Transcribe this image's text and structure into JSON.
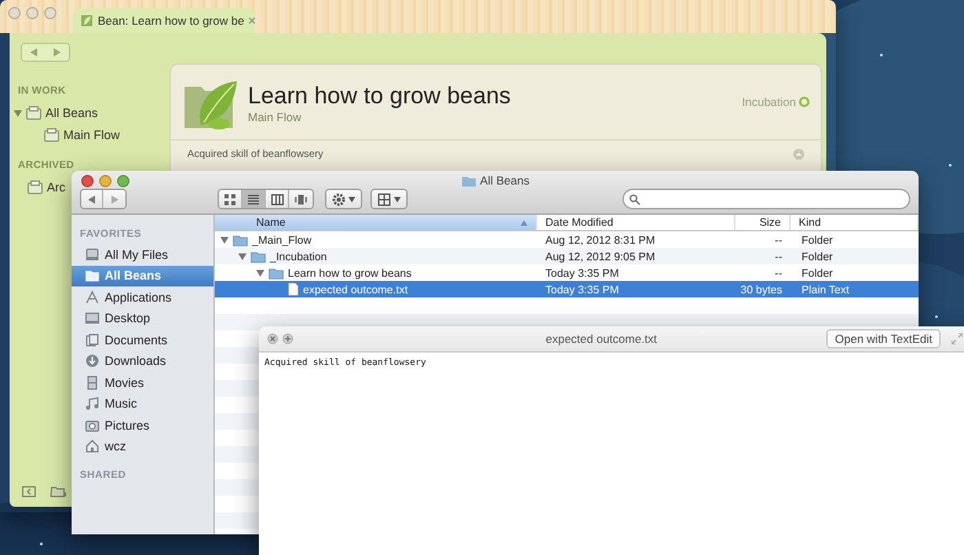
{
  "bean_window": {
    "tab_title": "Bean: Learn how to grow be",
    "sidebar": [
      {
        "heading": "IN WORK",
        "items": [
          {
            "label": "All Beans",
            "expanded": true,
            "children": [
              {
                "label": "Main Flow"
              }
            ]
          }
        ]
      },
      {
        "heading": "ARCHIVED",
        "items": [
          {
            "label": "Arc"
          }
        ]
      }
    ],
    "bean": {
      "title": "Learn how to grow beans",
      "subtitle": "Main Flow",
      "status": "Incubation",
      "note": "Acquired skill of beanflowsery"
    }
  },
  "finder": {
    "title": "All Beans",
    "view_modes": [
      {
        "kind": "icon",
        "selected": false
      },
      {
        "kind": "list",
        "selected": true
      },
      {
        "kind": "column",
        "selected": false
      },
      {
        "kind": "coverflow",
        "selected": false
      }
    ],
    "sidebar": [
      {
        "heading": "FAVORITES",
        "items": [
          {
            "label": "All My Files",
            "kind": "files",
            "selected": false
          },
          {
            "label": "All Beans",
            "kind": "folder",
            "selected": true
          },
          {
            "label": "Applications",
            "kind": "apps",
            "selected": false
          },
          {
            "label": "Desktop",
            "kind": "desktop",
            "selected": false
          },
          {
            "label": "Documents",
            "kind": "documents",
            "selected": false
          },
          {
            "label": "Downloads",
            "kind": "downloads",
            "selected": false
          },
          {
            "label": "Movies",
            "kind": "movies",
            "selected": false
          },
          {
            "label": "Music",
            "kind": "music",
            "selected": false
          },
          {
            "label": "Pictures",
            "kind": "pictures",
            "selected": false
          },
          {
            "label": "wcz",
            "kind": "home",
            "selected": false
          }
        ]
      },
      {
        "heading": "SHARED"
      }
    ],
    "columns": [
      "Name",
      "Date Modified",
      "Size",
      "Kind"
    ],
    "rows": [
      {
        "name": "_Main_Flow",
        "date": "Aug 12, 2012 8:31 PM",
        "size": "--",
        "kind_label": "Folder",
        "kind": "folder",
        "expanded": true,
        "selected": false,
        "children": [
          {
            "name": "_Incubation",
            "date": "Aug 12, 2012 9:05 PM",
            "size": "--",
            "kind_label": "Folder",
            "kind": "folder",
            "expanded": true,
            "selected": false,
            "children": [
              {
                "name": "Learn how to grow beans",
                "date": "Today 3:35 PM",
                "size": "--",
                "kind_label": "Folder",
                "kind": "folder",
                "expanded": true,
                "selected": false,
                "children": [
                  {
                    "name": "expected outcome.txt",
                    "date": "Today 3:35 PM",
                    "size": "30 bytes",
                    "kind_label": "Plain Text",
                    "kind": "file",
                    "selected": true
                  }
                ]
              }
            ]
          }
        ]
      }
    ]
  },
  "quicklook": {
    "title": "expected outcome.txt",
    "button": "Open with TextEdit",
    "content": "Acquired skill of beanflowsery"
  }
}
